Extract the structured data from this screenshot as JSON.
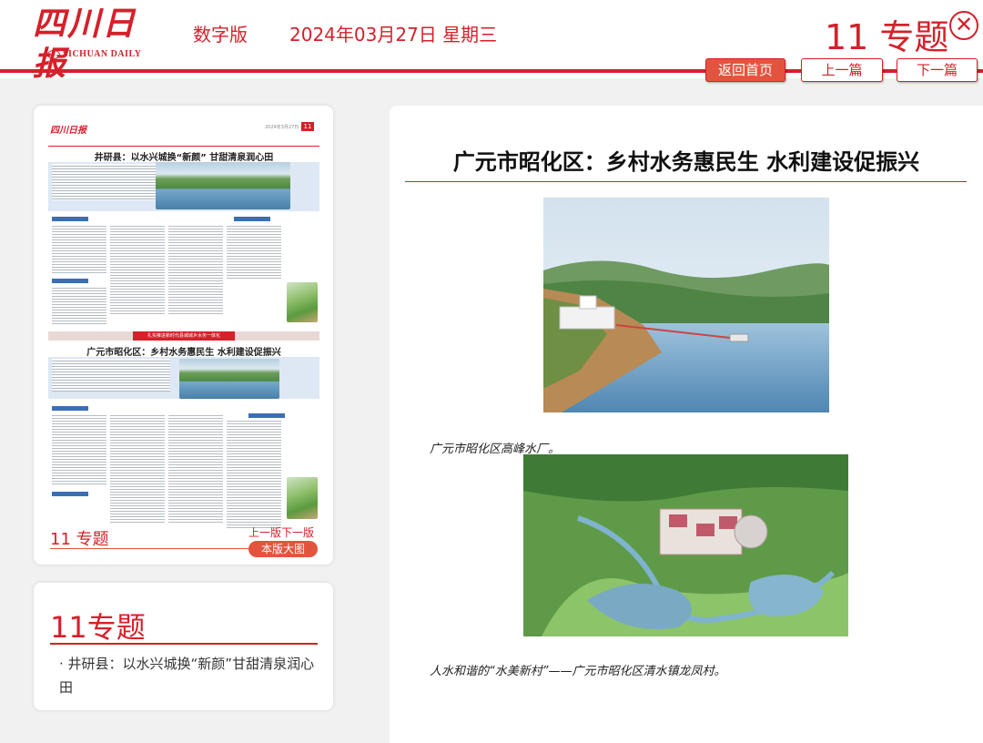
{
  "header": {
    "logo_cn": "四川日报",
    "logo_en": "SICHUAN DAILY",
    "edition": "数字版",
    "date": "2024年03月27日 星期三",
    "page_title": "11 专题",
    "close_icon": "close-circle-icon",
    "nav": {
      "home": "返回首页",
      "prev": "上一篇",
      "next": "下一篇"
    },
    "accent_color": "#d6202a"
  },
  "thumbnail": {
    "paper_logo": "四川日报",
    "paper_date": "2024年3月27日 星期三",
    "paper_page": "11",
    "headline_1": "井研县：以水兴城换“新颜” 甘甜清泉润心田",
    "banner": "扎实推进新时代县城城乡水务一体化",
    "headline_2": "广元市昭化区：乡村水务惠民生 水利建设促振兴",
    "page_label": "11 专题",
    "prev_label": "上一版",
    "next_label": "下一版",
    "big_view_label": "本版大图"
  },
  "list_card": {
    "title": "11专题",
    "items": [
      "· 井研县：以水兴城换“新颜”甘甜清泉润心田"
    ]
  },
  "article": {
    "title": "广元市昭化区：乡村水务惠民生 水利建设促振兴",
    "captions": [
      "广元市昭化区高峰水厂。",
      "人水和谐的“水美新村”——广元市昭化区清水镇龙凤村。"
    ]
  }
}
